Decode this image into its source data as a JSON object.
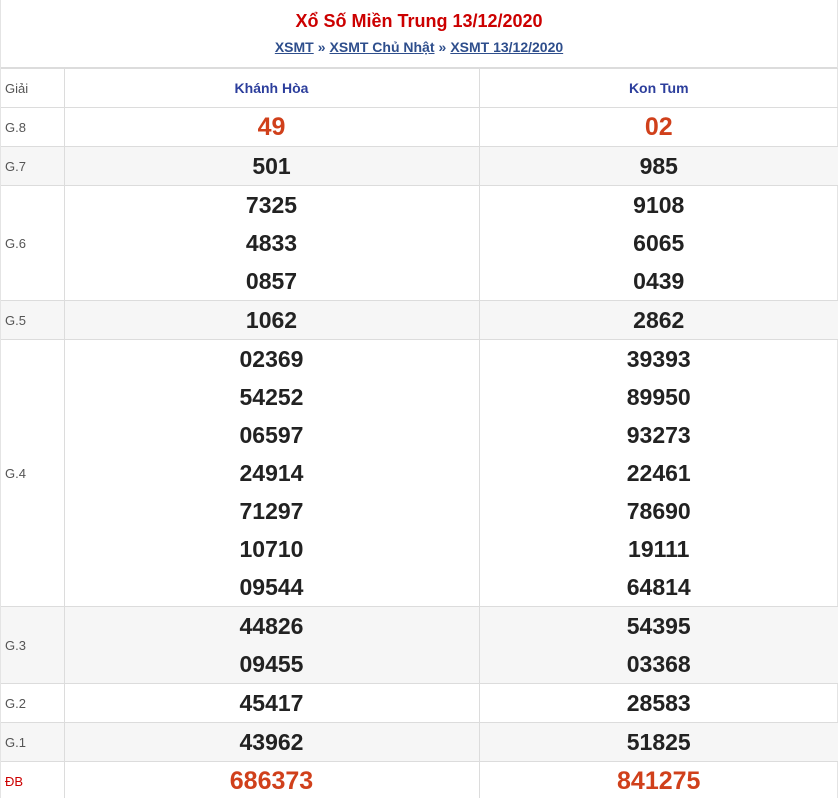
{
  "header": {
    "title": "Xổ Số Miền Trung 13/12/2020",
    "breadcrumb": [
      "XSMT",
      "XSMT Chủ Nhật",
      "XSMT 13/12/2020"
    ],
    "separator": "»"
  },
  "table": {
    "giai_label": "Giải",
    "provinces": [
      "Khánh Hòa",
      "Kon Tum"
    ],
    "rows": [
      {
        "label": "G.8",
        "highlight": true,
        "col1": [
          "49"
        ],
        "col2": [
          "02"
        ]
      },
      {
        "label": "G.7",
        "highlight": false,
        "col1": [
          "501"
        ],
        "col2": [
          "985"
        ]
      },
      {
        "label": "G.6",
        "highlight": false,
        "col1": [
          "7325",
          "4833",
          "0857"
        ],
        "col2": [
          "9108",
          "6065",
          "0439"
        ]
      },
      {
        "label": "G.5",
        "highlight": false,
        "col1": [
          "1062"
        ],
        "col2": [
          "2862"
        ]
      },
      {
        "label": "G.4",
        "highlight": false,
        "col1": [
          "02369",
          "54252",
          "06597",
          "24914",
          "71297",
          "10710",
          "09544"
        ],
        "col2": [
          "39393",
          "89950",
          "93273",
          "22461",
          "78690",
          "19111",
          "64814"
        ]
      },
      {
        "label": "G.3",
        "highlight": false,
        "col1": [
          "44826",
          "09455"
        ],
        "col2": [
          "54395",
          "03368"
        ]
      },
      {
        "label": "G.2",
        "highlight": false,
        "col1": [
          "45417"
        ],
        "col2": [
          "28583"
        ]
      },
      {
        "label": "G.1",
        "highlight": false,
        "col1": [
          "43962"
        ],
        "col2": [
          "51825"
        ]
      },
      {
        "label": "ĐB",
        "highlight": true,
        "col1": [
          "686373"
        ],
        "col2": [
          "841275"
        ]
      }
    ]
  },
  "colors": {
    "title": "#cc0000",
    "link": "#2e4e8c",
    "province": "#2c3e9c",
    "highlight_number": "#d0401b"
  }
}
